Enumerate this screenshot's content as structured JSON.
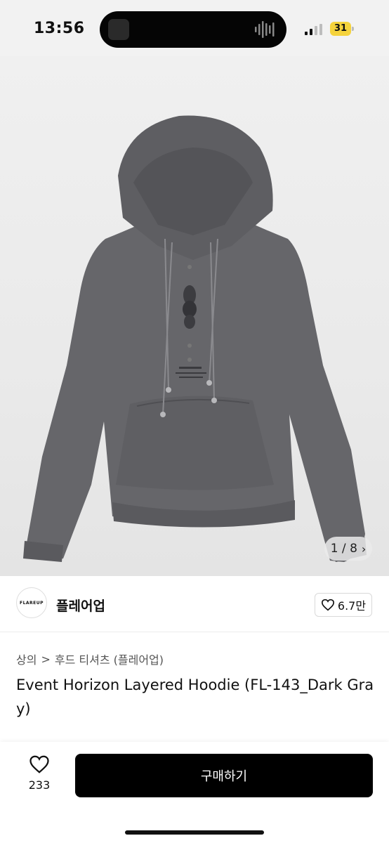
{
  "status_bar": {
    "time": "13:56",
    "battery": "31"
  },
  "gallery": {
    "image_alt": "hoodie-product-photo",
    "counter_current": "1",
    "counter_separator": "/",
    "counter_total": "8",
    "next_icon": "chevron-right-icon"
  },
  "seller": {
    "logo_text": "FLAREUP",
    "name": "플레어업",
    "likes": "6.7만"
  },
  "breadcrumb": {
    "category": "상의",
    "separator": ">",
    "subcategory": "후드 티셔츠 (플레어업)"
  },
  "product": {
    "title": "Event Horizon Layered Hoodie (FL-143_Dark Gray)"
  },
  "bottom_bar": {
    "wish_count": "233",
    "buy_label": "구매하기"
  },
  "colors": {
    "buy_button": "#000000",
    "battery": "#f5d33c",
    "hoodie": "#66666a"
  }
}
